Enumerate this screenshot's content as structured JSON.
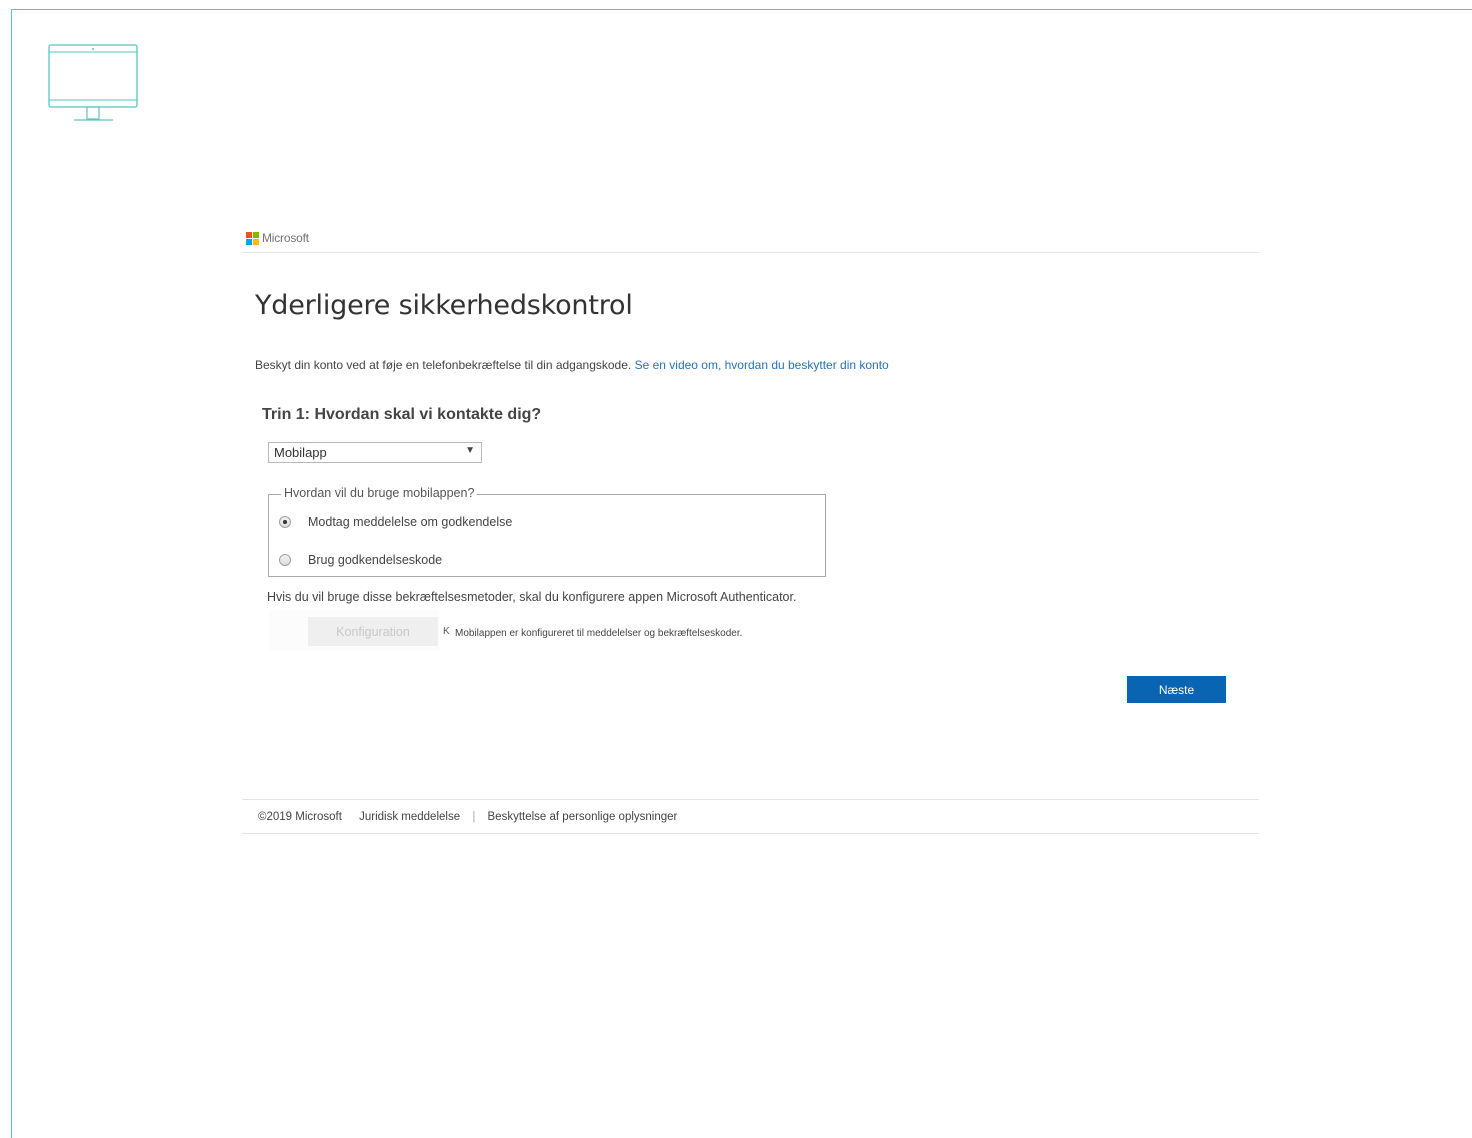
{
  "brand": {
    "name": "Microsoft",
    "colors": [
      "#f25022",
      "#7fba00",
      "#00a4ef",
      "#ffb900"
    ]
  },
  "page": {
    "title": "Yderligere sikkerhedskontrol",
    "intro_text": "Beskyt din konto ved at føje en telefonbekræftelse til din adgangskode.",
    "intro_link": "Se en video om, hvordan du beskytter din konto"
  },
  "step1": {
    "heading": "Trin 1: Hvordan skal vi kontakte dig?",
    "contact_method": {
      "selected": "Mobilapp"
    }
  },
  "mobile_app": {
    "legend": "Hvordan vil du bruge mobilappen?",
    "options": [
      {
        "label": "Modtag meddelelse om godkendelse",
        "checked": true
      },
      {
        "label": "Brug godkendelseskode",
        "checked": false
      }
    ],
    "note": "Hvis du vil bruge disse bekræftelsesmetoder, skal du konfigurere appen Microsoft Authenticator.",
    "config_button": "Konfiguration",
    "config_marker": "K",
    "config_status": "Mobilappen er konfigureret til meddelelser og bekræftelseskoder."
  },
  "actions": {
    "next": "Næste"
  },
  "footer": {
    "copyright": "©2019 Microsoft",
    "legal": "Juridisk meddelelse",
    "separator": "|",
    "privacy": "Beskyttelse af personlige oplysninger"
  },
  "theme": {
    "accent": "#0a64b4",
    "link": "#2672c1",
    "frame": "#5bc4c4"
  }
}
